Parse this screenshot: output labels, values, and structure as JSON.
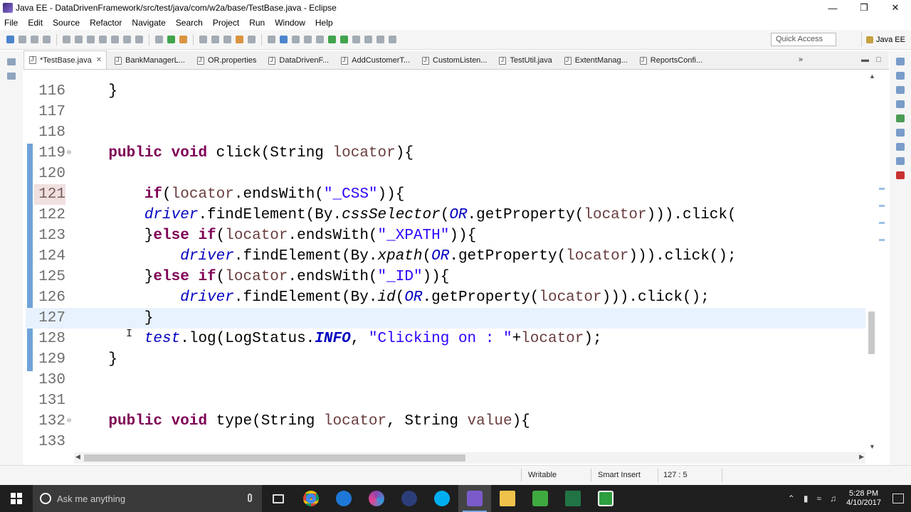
{
  "window": {
    "title": "Java EE - DataDrivenFramework/src/test/java/com/w2a/base/TestBase.java - Eclipse",
    "controls": [
      "minimize-icon",
      "restore-icon",
      "close-icon"
    ]
  },
  "menu": [
    "File",
    "Edit",
    "Source",
    "Refactor",
    "Navigate",
    "Search",
    "Project",
    "Run",
    "Window",
    "Help"
  ],
  "toolbar": {
    "quick_access": "Quick Access",
    "perspective": "Java EE"
  },
  "tabs": [
    {
      "label": "*TestBase.java",
      "active": true,
      "closable": true
    },
    {
      "label": "BankManagerL...",
      "active": false
    },
    {
      "label": "OR.properties",
      "active": false
    },
    {
      "label": "DataDrivenF...",
      "active": false
    },
    {
      "label": "AddCustomerT...",
      "active": false
    },
    {
      "label": "CustomListen...",
      "active": false
    },
    {
      "label": "TestUtil.java",
      "active": false
    },
    {
      "label": "ExtentManag...",
      "active": false
    },
    {
      "label": "ReportsConfi...",
      "active": false
    }
  ],
  "tabs_overflow": "»",
  "code_lines": [
    {
      "n": "116",
      "html": "    }"
    },
    {
      "n": "117",
      "html": ""
    },
    {
      "n": "118",
      "html": ""
    },
    {
      "n": "119",
      "fold": true,
      "html": "    <span class='kw'>public</span> <span class='kw'>void</span> click(String <span class='vr'>locator</span>){"
    },
    {
      "n": "120",
      "html": ""
    },
    {
      "n": "121",
      "highlight": true,
      "html": "        <span class='kw'>if</span>(<span class='vr'>locator</span>.endsWith(<span class='st'>\"_CSS\"</span>)){"
    },
    {
      "n": "122",
      "html": "        <span class='fd'>driver</span>.findElement(By.<span class='it'>cssSelector</span>(<span class='fd'>OR</span>.getProperty(<span class='vr'>locator</span>))).click("
    },
    {
      "n": "123",
      "html": "        }<span class='kw'>else</span> <span class='kw'>if</span>(<span class='vr'>locator</span>.endsWith(<span class='st'>\"_XPATH\"</span>)){"
    },
    {
      "n": "124",
      "html": "            <span class='fd'>driver</span>.findElement(By.<span class='it'>xpath</span>(<span class='fd'>OR</span>.getProperty(<span class='vr'>locator</span>))).click();"
    },
    {
      "n": "125",
      "html": "        }<span class='kw'>else</span> <span class='kw'>if</span>(<span class='vr'>locator</span>.endsWith(<span class='st'>\"_ID\"</span>)){"
    },
    {
      "n": "126",
      "html": "            <span class='fd'>driver</span>.findElement(By.<span class='it'>id</span>(<span class='fd'>OR</span>.getProperty(<span class='vr'>locator</span>))).click();"
    },
    {
      "n": "127",
      "current": true,
      "html": "        }"
    },
    {
      "n": "128",
      "html": "        <span class='fd'>test</span>.log(LogStatus.<span class='fd' style='font-weight:bold'>INFO</span>, <span class='st'>\"Clicking on : \"</span>+<span class='vr'>locator</span>);"
    },
    {
      "n": "129",
      "html": "    }"
    },
    {
      "n": "130",
      "html": ""
    },
    {
      "n": "131",
      "html": ""
    },
    {
      "n": "132",
      "fold": true,
      "html": "    <span class='kw'>public</span> <span class='kw'>void</span> type(String <span class='vr'>locator</span>, String <span class='vr'>value</span>){"
    },
    {
      "n": "133",
      "html": ""
    }
  ],
  "status": {
    "writable": "Writable",
    "insert_mode": "Smart Insert",
    "position": "127 : 5"
  },
  "taskbar": {
    "search_placeholder": "Ask me anything",
    "apps": [
      "task-view-icon",
      "chrome-icon",
      "edge-icon",
      "browser-icon",
      "vpn-icon",
      "skype-icon",
      "eclipse-icon",
      "file-explorer-icon",
      "camtasia-icon",
      "excel-icon",
      "camtasia-recorder-icon"
    ],
    "time": "5:28 PM",
    "date": "4/10/2017"
  }
}
